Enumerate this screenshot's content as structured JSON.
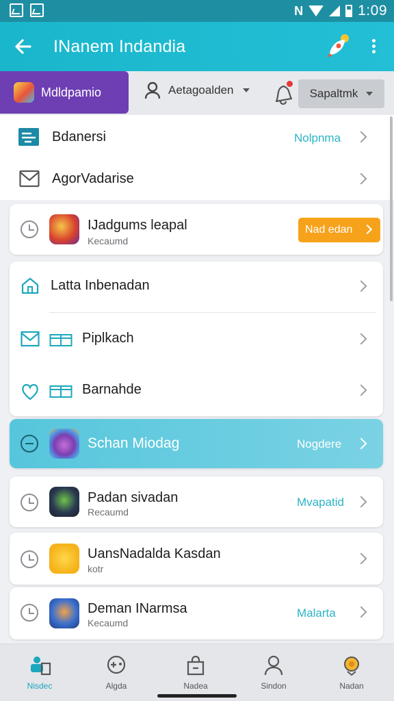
{
  "status_bar": {
    "time": "1:09",
    "nfc": "N"
  },
  "app_bar": {
    "title": "INanem Indandia"
  },
  "filter_bar": {
    "primary_chip": "Mdldpamio",
    "person_filter": "Aetagoalden",
    "select_value": "Sapaltmk"
  },
  "list_top": [
    {
      "label": "Bdanersi",
      "meta": "Nolpnma"
    },
    {
      "label": "AgorVadarise",
      "meta": ""
    }
  ],
  "featured": {
    "title": "IJadgums leapal",
    "subtitle": "Kecaumd",
    "action": "Nad edan"
  },
  "group": [
    {
      "label": "Latta Inbenadan"
    },
    {
      "label": "Piplkach"
    },
    {
      "label": "Barnahde"
    }
  ],
  "highlight": {
    "title": "Schan Miodag",
    "meta": "Nogdere"
  },
  "apps": [
    {
      "title": "Padan sivadan",
      "subtitle": "Recaumd",
      "meta": "Mvapatid"
    },
    {
      "title": "UansNadalda Kasdan",
      "subtitle": "kotr",
      "meta": ""
    },
    {
      "title": "Deman INarmsa",
      "subtitle": "Kecaumd",
      "meta": "Malarta"
    }
  ],
  "bottom_nav": [
    {
      "label": "Nisdec",
      "icon": "home-store-icon"
    },
    {
      "label": "Algda",
      "icon": "gamepad-icon"
    },
    {
      "label": "Nadea",
      "icon": "shopping-bag-icon"
    },
    {
      "label": "Sindon",
      "icon": "person-icon"
    },
    {
      "label": "Nadan",
      "icon": "coin-icon"
    }
  ],
  "colors": {
    "accent": "#1ab6cc",
    "primary_chip": "#6d3fb3",
    "orange": "#f7a21b",
    "highlight": "#56c6dc"
  }
}
